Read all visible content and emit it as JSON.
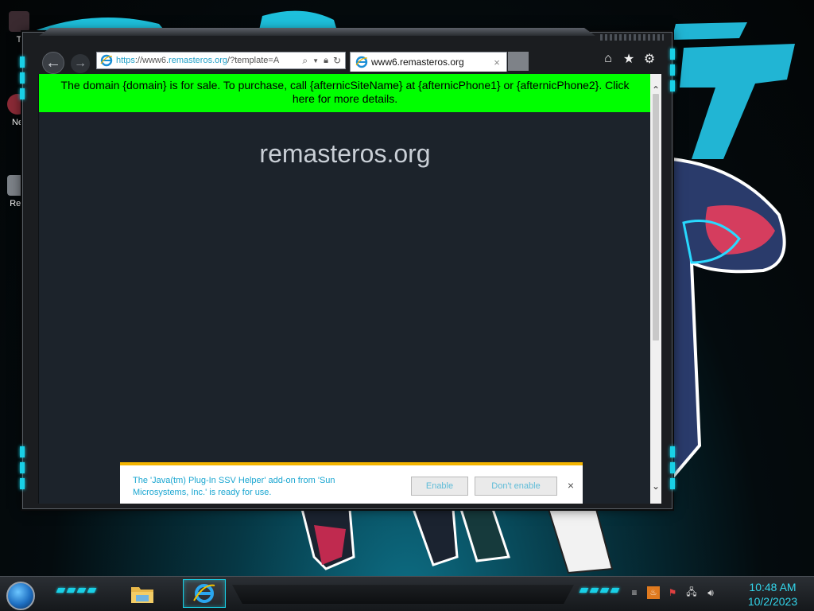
{
  "desktop": {
    "icons": [
      {
        "label": "T"
      },
      {
        "label": "Ne"
      },
      {
        "label": "Rec"
      }
    ]
  },
  "browser": {
    "address": {
      "protocol": "https",
      "prefix": "://www6.",
      "host": "remasteros.org",
      "path": "/?template=A"
    },
    "tab": {
      "title": "www6.remasteros.org",
      "close_glyph": "×"
    },
    "icons": {
      "back": "arrow-left-icon",
      "forward": "arrow-right-icon",
      "home": "home-icon",
      "favorites": "star-icon",
      "tools": "gear-icon",
      "search": "search-icon",
      "lock": "lock-icon",
      "refresh": "refresh-icon"
    }
  },
  "page": {
    "banner_text": "The domain {domain} is for sale. To purchase, call {afternicSiteName} at {afternicPhone1} or {afternicPhone2}. Click here for more details.",
    "site_title": "remasteros.org",
    "banner_color": "#00ff00",
    "background_color": "#1c232b"
  },
  "notification": {
    "message": "The 'Java(tm) Plug-In SSV Helper' add-on from 'Sun Microsystems, Inc.' is ready for use.",
    "enable_label": "Enable",
    "disable_label": "Don't enable",
    "close_glyph": "×"
  },
  "taskbar": {
    "time": "10:48 AM",
    "date": "10/2/2023",
    "pinned": [
      "file-explorer-icon",
      "internet-explorer-icon"
    ],
    "accent_color": "#19d0e6"
  }
}
